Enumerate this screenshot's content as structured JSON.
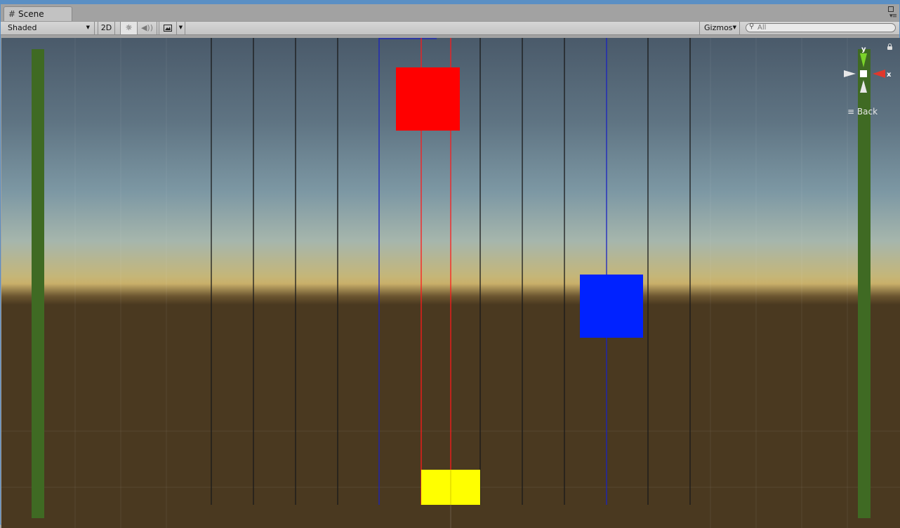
{
  "tab": {
    "icon": "grid-hash-icon",
    "label": "Scene"
  },
  "toolbar": {
    "draw_mode": "Shaded",
    "mode_2d": "2D",
    "lighting_icon": "sun-icon",
    "audio_icon": "speaker-icon",
    "effects_icon": "image-icon",
    "gizmos": "Gizmos",
    "search_placeholder": "All"
  },
  "orientation_gizmo": {
    "axis_y": "y",
    "axis_x": "x",
    "view_label": "Back",
    "colors": {
      "y": "#7ad22a",
      "x": "#e0382c",
      "center": "#ffffff"
    }
  },
  "scene": {
    "colors": {
      "red_block": "#ff0000",
      "blue_block": "#0022ff",
      "yellow_block": "#ffff00",
      "pillar": "#3f6a23",
      "sky_top": "#4a5a6a",
      "horizon": "#c9b06a",
      "ground": "#4a3920"
    }
  }
}
